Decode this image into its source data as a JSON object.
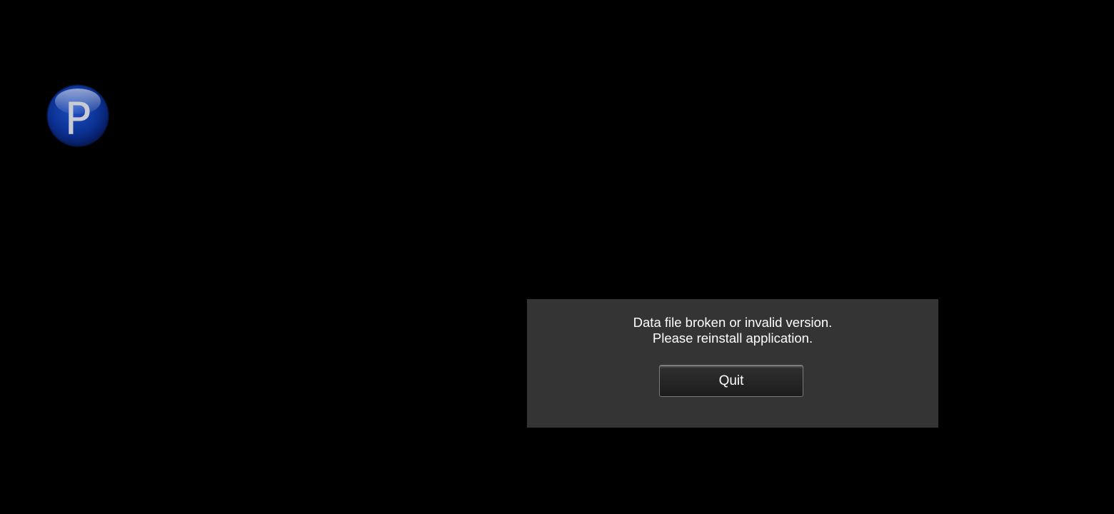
{
  "logo": {
    "letter": "P",
    "icon": "p-app-logo-icon",
    "color": "#0a2f8f"
  },
  "dialog": {
    "message_line1": "Data file broken or invalid version.",
    "message_line2": "Please reinstall application.",
    "quit_label": "Quit",
    "background": "#343434"
  }
}
